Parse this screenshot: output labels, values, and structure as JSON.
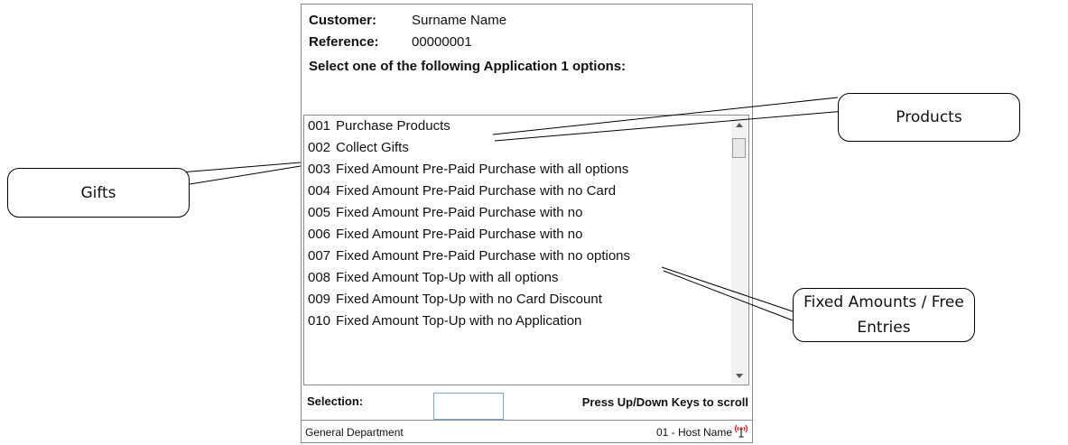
{
  "customer": {
    "label": "Customer:",
    "value": "Surname Name"
  },
  "reference": {
    "label": "Reference:",
    "value": "00000001"
  },
  "prompt": "Select one of the following Application 1 options:",
  "options": [
    {
      "code": "001",
      "label": "Purchase Products"
    },
    {
      "code": "002",
      "label": "Collect Gifts"
    },
    {
      "code": "003",
      "label": "Fixed Amount Pre-Paid Purchase with all options"
    },
    {
      "code": "004",
      "label": "Fixed Amount Pre-Paid Purchase with no Card"
    },
    {
      "code": "005",
      "label": "Fixed Amount Pre-Paid Purchase with no"
    },
    {
      "code": "006",
      "label": "Fixed Amount Pre-Paid Purchase with no"
    },
    {
      "code": "007",
      "label": "Fixed Amount Pre-Paid Purchase with no options"
    },
    {
      "code": "008",
      "label": "Fixed Amount Top-Up with all options"
    },
    {
      "code": "009",
      "label": "Fixed Amount Top-Up with no Card Discount"
    },
    {
      "code": "010",
      "label": "Fixed Amount Top-Up with no Application"
    }
  ],
  "selection": {
    "label": "Selection:",
    "value": "",
    "hint": "Press Up/Down Keys to scroll"
  },
  "status": {
    "department": "General Department",
    "host": "01 - Host Name",
    "icon": "antenna-icon"
  },
  "callouts": {
    "products": "Products",
    "gifts": "Gifts",
    "fixed": "Fixed Amounts / Free Entries"
  },
  "colors": {
    "input_border": "#7fa6c8",
    "antenna": "#cc2222"
  }
}
